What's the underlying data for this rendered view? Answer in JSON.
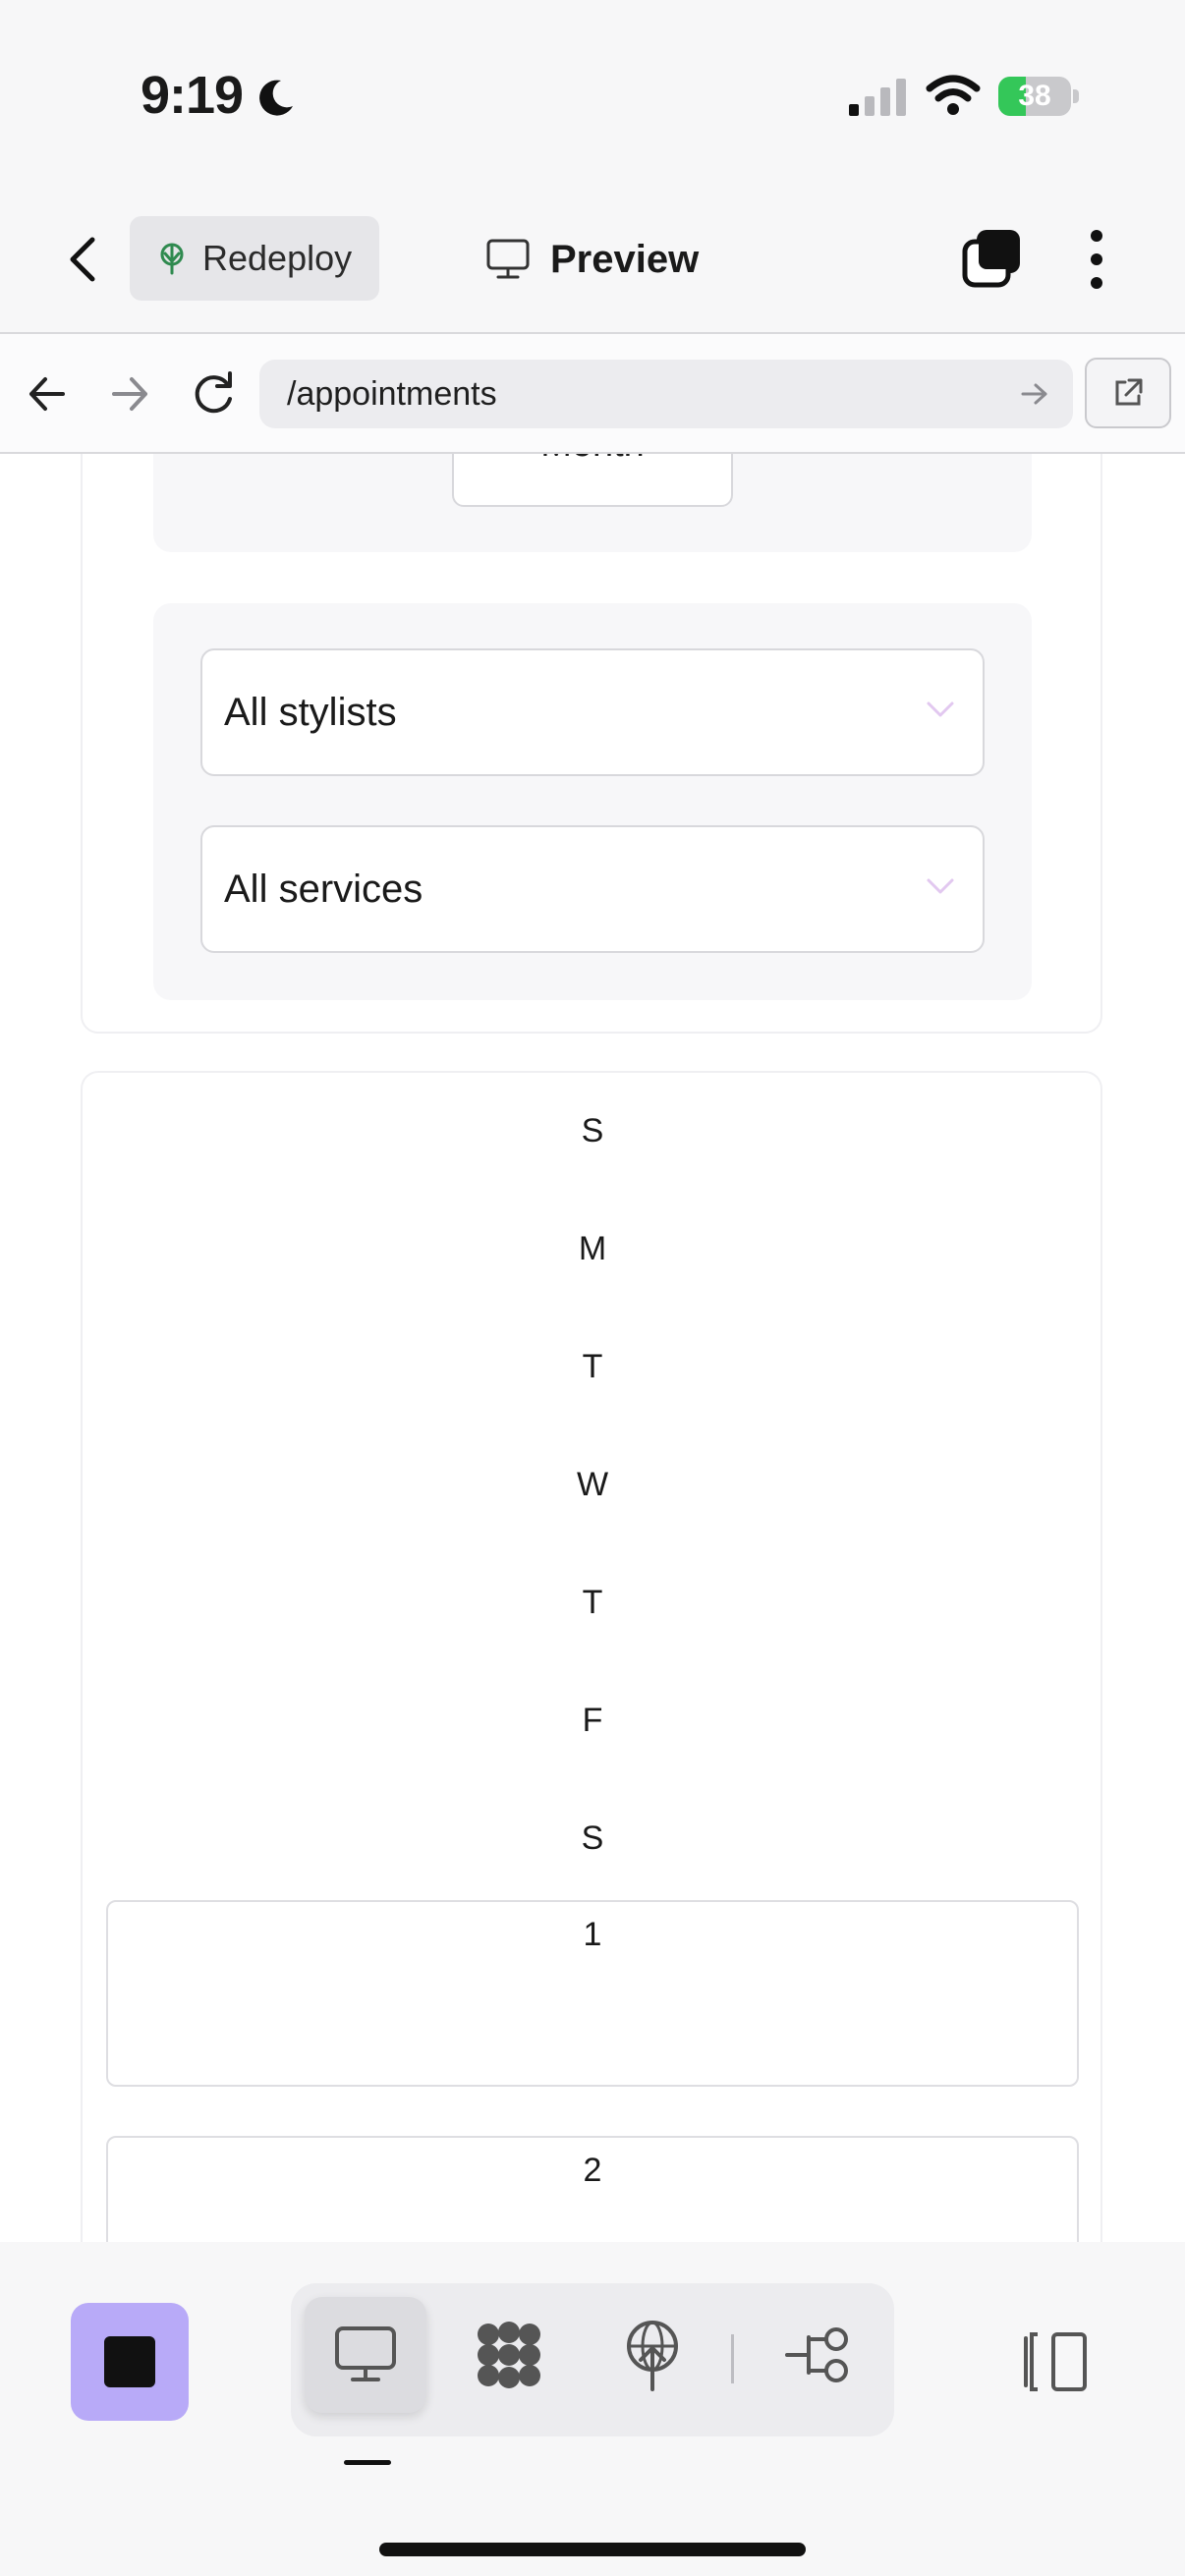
{
  "status_bar": {
    "time": "9:19",
    "battery_percent": 38,
    "battery_label": "38",
    "icons": [
      "moon-icon",
      "cellular-signal-icon",
      "wifi-icon",
      "battery-charging-icon"
    ]
  },
  "header": {
    "back_icon": "chevron-left-icon",
    "redeploy_label": "Redeploy",
    "redeploy_icon": "deploy-tree-icon",
    "title": "Preview",
    "title_icon": "monitor-icon",
    "actions": [
      "stack-windows-icon",
      "more-vertical-icon"
    ]
  },
  "browser": {
    "url": "/appointments",
    "icons": [
      "arrow-left-icon",
      "arrow-right-icon",
      "reload-icon",
      "go-arrow-icon",
      "open-external-icon"
    ]
  },
  "filters": {
    "view_mode_partial": "Month",
    "stylist_select": "All stylists",
    "service_select": "All services",
    "chevron_color": "#e2c8f0"
  },
  "calendar": {
    "weekdays": [
      "S",
      "M",
      "T",
      "W",
      "T",
      "F",
      "S"
    ],
    "days": [
      "1",
      "2"
    ]
  },
  "toolbar": {
    "stop_color": "#b8aaf8",
    "items": [
      "desktop-preview-icon",
      "dots-cluster-icon",
      "globe-deploy-icon",
      "branch-flow-icon"
    ],
    "active_item": "desktop-preview-icon",
    "panel_icon": "side-panel-icon"
  }
}
